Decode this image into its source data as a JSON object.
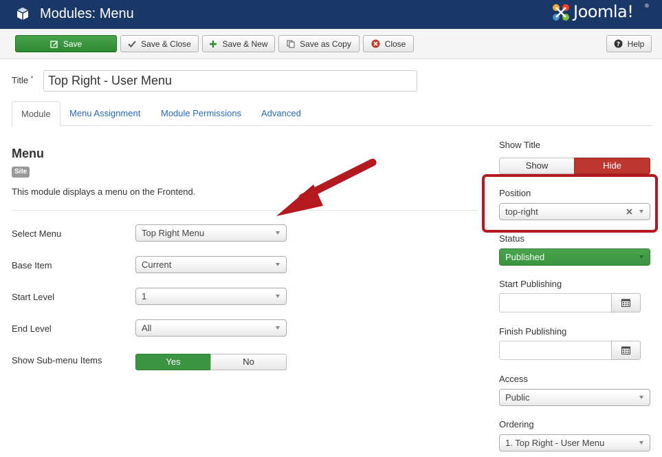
{
  "header": {
    "title": "Modules: Menu",
    "logo_text": "Joomla!",
    "logo_reg": "®",
    "bg_color": "#1a3867"
  },
  "toolbar": {
    "save": "Save",
    "save_close": "Save & Close",
    "save_new": "Save & New",
    "save_copy": "Save as Copy",
    "close": "Close",
    "help": "Help"
  },
  "title_field": {
    "label": "Title",
    "required_mark": "*",
    "value": "Top Right - User Menu"
  },
  "tabs": [
    {
      "label": "Module",
      "active": true
    },
    {
      "label": "Menu Assignment",
      "active": false
    },
    {
      "label": "Module Permissions",
      "active": false
    },
    {
      "label": "Advanced",
      "active": false
    }
  ],
  "module": {
    "heading": "Menu",
    "badge": "Site",
    "description": "This module displays a menu on the Frontend."
  },
  "options": {
    "select_menu": {
      "label": "Select Menu",
      "value": "Top Right Menu"
    },
    "base_item": {
      "label": "Base Item",
      "value": "Current"
    },
    "start_level": {
      "label": "Start Level",
      "value": "1"
    },
    "end_level": {
      "label": "End Level",
      "value": "All"
    },
    "show_submenu": {
      "label": "Show Sub-menu Items",
      "yes": "Yes",
      "no": "No",
      "selected": "Yes"
    }
  },
  "sidebar": {
    "show_title": {
      "label": "Show Title",
      "show": "Show",
      "hide": "Hide",
      "selected": "Hide"
    },
    "position": {
      "label": "Position",
      "value": "top-right"
    },
    "status": {
      "label": "Status",
      "value": "Published"
    },
    "start_publishing": {
      "label": "Start Publishing",
      "value": ""
    },
    "finish_publishing": {
      "label": "Finish Publishing",
      "value": ""
    },
    "access": {
      "label": "Access",
      "value": "Public"
    },
    "ordering": {
      "label": "Ordering",
      "value": "1. Top Right - User Menu"
    }
  },
  "colors": {
    "accent_green": "#3a9440",
    "hide_red": "#bd362f",
    "annotation_red": "#b3191e",
    "link_blue": "#2a69b8"
  }
}
